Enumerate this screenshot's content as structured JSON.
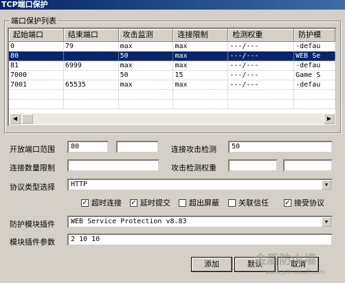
{
  "window": {
    "title": "TCP端口保护"
  },
  "group": {
    "label": "端口保护列表"
  },
  "table": {
    "columns": [
      "起始端口",
      "结束端口",
      "攻击监测",
      "连接限制",
      "检测权重",
      "防护模"
    ],
    "rows": [
      [
        "0",
        "79",
        "max",
        "max",
        "---/---",
        "-defau"
      ],
      [
        "80",
        "",
        "50",
        "max",
        "---/---",
        "WEB Se"
      ],
      [
        "81",
        "6999",
        "max",
        "max",
        "---/---",
        "-defau"
      ],
      [
        "7000",
        "",
        "50",
        "15",
        "---/---",
        "Game S"
      ],
      [
        "7001",
        "65535",
        "max",
        "max",
        "---/---",
        "-defau"
      ]
    ],
    "selected_index": 1
  },
  "form": {
    "open_port_range_label": "开放端口范围",
    "open_port_from": "80",
    "open_port_to": "",
    "conn_attack_detect_label": "连接攻击检测",
    "conn_attack_detect_value": "50",
    "conn_limit_label": "连接数量限制",
    "conn_limit_value": "",
    "attack_weight_label": "攻击检测权重",
    "attack_weight_a": "",
    "attack_weight_b": "",
    "protocol_label": "协议类型选择",
    "protocol_value": "HTTP",
    "module_label": "防护模块插件",
    "module_value": "WEB Service Protection v8.83",
    "params_label": "模块插件参数",
    "params_value": "2 10 10"
  },
  "checkboxes": [
    {
      "label": "超时连接",
      "checked": true
    },
    {
      "label": "延时提交",
      "checked": true
    },
    {
      "label": "超出屏蔽",
      "checked": false
    },
    {
      "label": "关联信任",
      "checked": false
    },
    {
      "label": "接受协议",
      "checked": true
    }
  ],
  "buttons": {
    "add": "添加",
    "default": "默认",
    "cancel": "取消"
  },
  "watermark": {
    "text": "金盾防火墙",
    "url": "www.jdfirewall.com"
  }
}
